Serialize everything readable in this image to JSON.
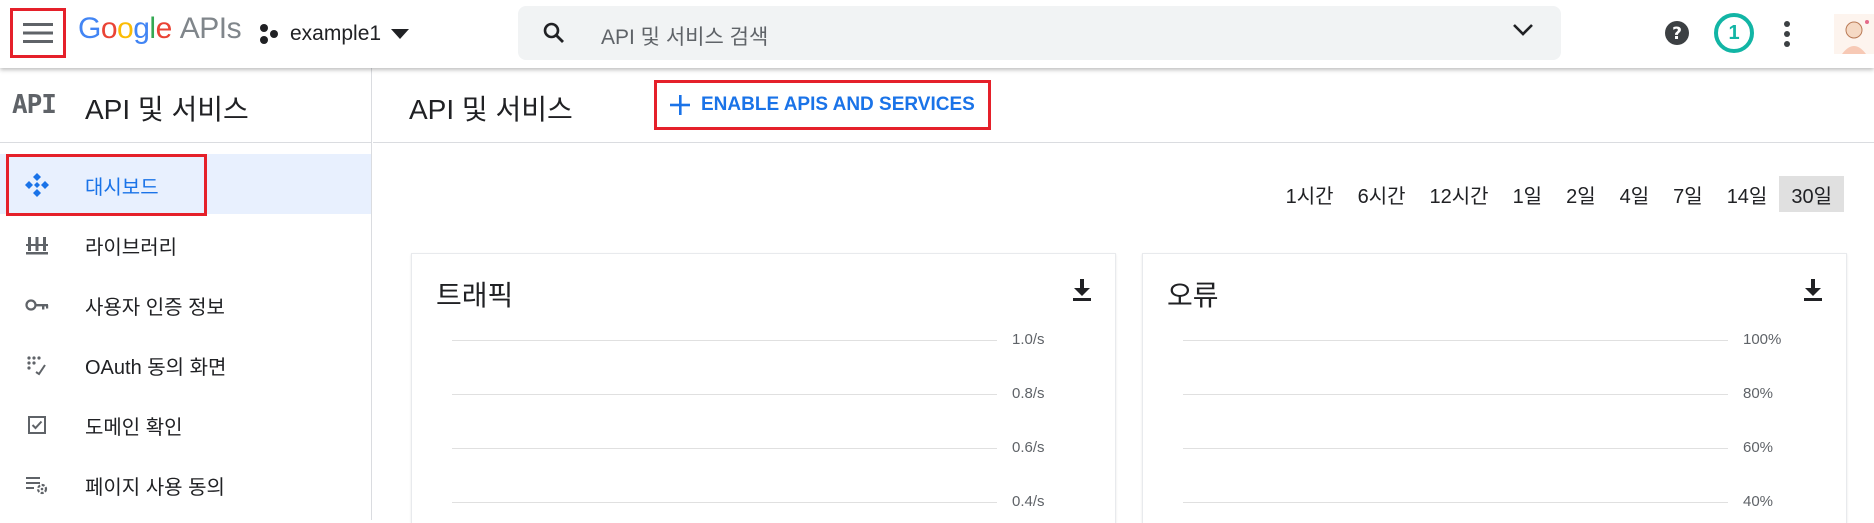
{
  "topbar": {
    "logo_google": [
      "G",
      "o",
      "o",
      "g",
      "l",
      "e"
    ],
    "logo_apis": "APIs",
    "project_name": "example1",
    "search_placeholder": "API 및 서비스 검색",
    "notification_count": "1",
    "icons": [
      "menu-icon",
      "project-icon",
      "search-icon",
      "chevron-down-icon",
      "help-icon",
      "more-vert-icon",
      "avatar"
    ]
  },
  "sidebar": {
    "logo": "API",
    "title": "API 및 서비스",
    "items": [
      {
        "label": "대시보드",
        "icon": "dashboard-icon",
        "active": true
      },
      {
        "label": "라이브러리",
        "icon": "library-icon"
      },
      {
        "label": "사용자 인증 정보",
        "icon": "key-icon"
      },
      {
        "label": "OAuth 동의 화면",
        "icon": "oauth-icon"
      },
      {
        "label": "도메인 확인",
        "icon": "checkbox-icon"
      },
      {
        "label": "페이지 사용 동의",
        "icon": "settings-list-icon"
      }
    ]
  },
  "main": {
    "title": "API 및 서비스",
    "enable_button": "ENABLE APIS AND SERVICES",
    "time_ranges": [
      "1시간",
      "6시간",
      "12시간",
      "1일",
      "2일",
      "4일",
      "7일",
      "14일",
      "30일"
    ],
    "selected_range": "30일",
    "cards": [
      {
        "title": "트래픽",
        "ticks": [
          "1.0/s",
          "0.8/s",
          "0.6/s",
          "0.4/s"
        ]
      },
      {
        "title": "오류",
        "ticks": [
          "100%",
          "80%",
          "60%",
          "40%"
        ]
      }
    ]
  },
  "colors": {
    "accent": "#1a73e8",
    "highlight": "#e5202a",
    "badge": "#12b5a5"
  }
}
